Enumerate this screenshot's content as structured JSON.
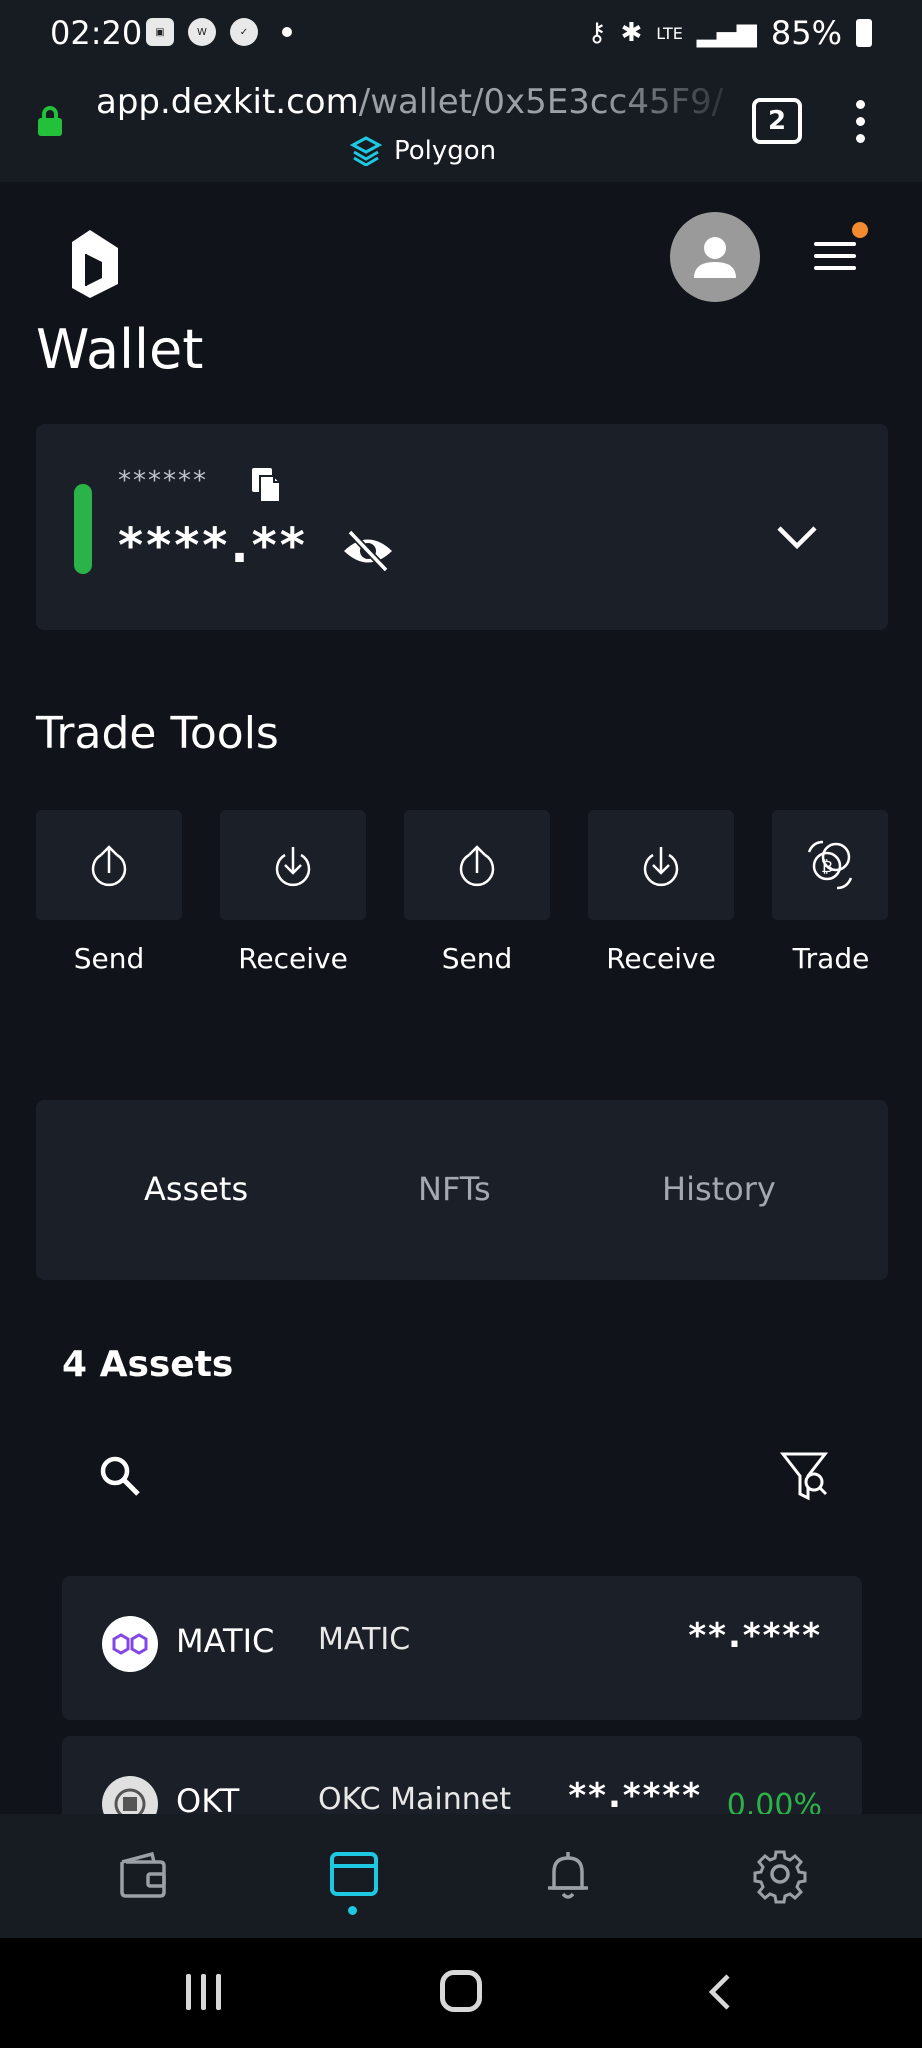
{
  "status_bar": {
    "time": "02:20",
    "battery": "85%",
    "signal_label": "LTE"
  },
  "browser": {
    "url_host": "app.dexkit.com",
    "url_path": "/wallet/0x5E3cc45F9/",
    "network_name": "Polygon",
    "tab_count": "2"
  },
  "header": {
    "title": "Wallet"
  },
  "wallet_card": {
    "masked_name": "******",
    "masked_balance": "****.**"
  },
  "trade_tools": {
    "title": "Trade Tools",
    "items": [
      {
        "label": "Send",
        "icon": "upload-icon"
      },
      {
        "label": "Receive",
        "icon": "download-icon"
      },
      {
        "label": "Send",
        "icon": "upload-icon"
      },
      {
        "label": "Receive",
        "icon": "download-icon"
      },
      {
        "label": "Trade",
        "icon": "bitcoin-swap-icon"
      }
    ]
  },
  "tabs": [
    {
      "label": "Assets",
      "active": true
    },
    {
      "label": "NFTs",
      "active": false
    },
    {
      "label": "History",
      "active": false
    }
  ],
  "assets": {
    "count_label": "4 Assets",
    "rows": [
      {
        "symbol": "MATIC",
        "network": "MATIC",
        "balance": "**.****",
        "change": ""
      },
      {
        "symbol": "OKT",
        "network": "OKC Mainnet",
        "balance": "**.****",
        "change": "0.00%"
      }
    ]
  },
  "bottom_nav": {
    "items": [
      "wallet-icon",
      "browser-icon",
      "bell-icon",
      "gear-icon"
    ],
    "active": "browser-icon"
  },
  "colors": {
    "background": "#101319",
    "card": "#1b1f27",
    "accent": "#1ec8e0",
    "positive": "#2bb34a",
    "notification": "#f28b30"
  }
}
